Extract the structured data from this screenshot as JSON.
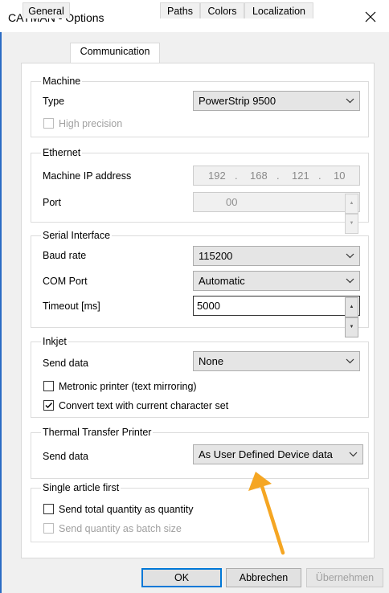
{
  "window": {
    "title": "CAYMAN - Options"
  },
  "tabs": [
    "General",
    "Communication",
    "Paths",
    "Colors",
    "Localization"
  ],
  "machine": {
    "legend": "Machine",
    "type_label": "Type",
    "type_value": "PowerStrip 9500",
    "high_precision_label": "High precision"
  },
  "ethernet": {
    "legend": "Ethernet",
    "ip_label": "Machine IP address",
    "ip": [
      "192",
      "168",
      "121",
      "10"
    ],
    "port_label": "Port",
    "port_value": "00"
  },
  "serial": {
    "legend": "Serial Interface",
    "baud_label": "Baud rate",
    "baud_value": "115200",
    "com_label": "COM Port",
    "com_value": "Automatic",
    "timeout_label": "Timeout [ms]",
    "timeout_value": "5000"
  },
  "inkjet": {
    "legend": "Inkjet",
    "send_label": "Send data",
    "send_value": "None",
    "metronic_label": "Metronic printer (text mirroring)",
    "convert_label": "Convert text with current character set"
  },
  "thermal": {
    "legend": "Thermal Transfer Printer",
    "send_label": "Send data",
    "send_value": "As User Defined Device data"
  },
  "single": {
    "legend": "Single article first",
    "total_label": "Send total quantity as quantity",
    "batch_label": "Send quantity as batch size"
  },
  "buttons": {
    "ok": "OK",
    "cancel": "Abbrechen",
    "apply": "Übernehmen"
  },
  "colors": {
    "accent": "#0078d7",
    "annotation_arrow": "#f5a623"
  }
}
